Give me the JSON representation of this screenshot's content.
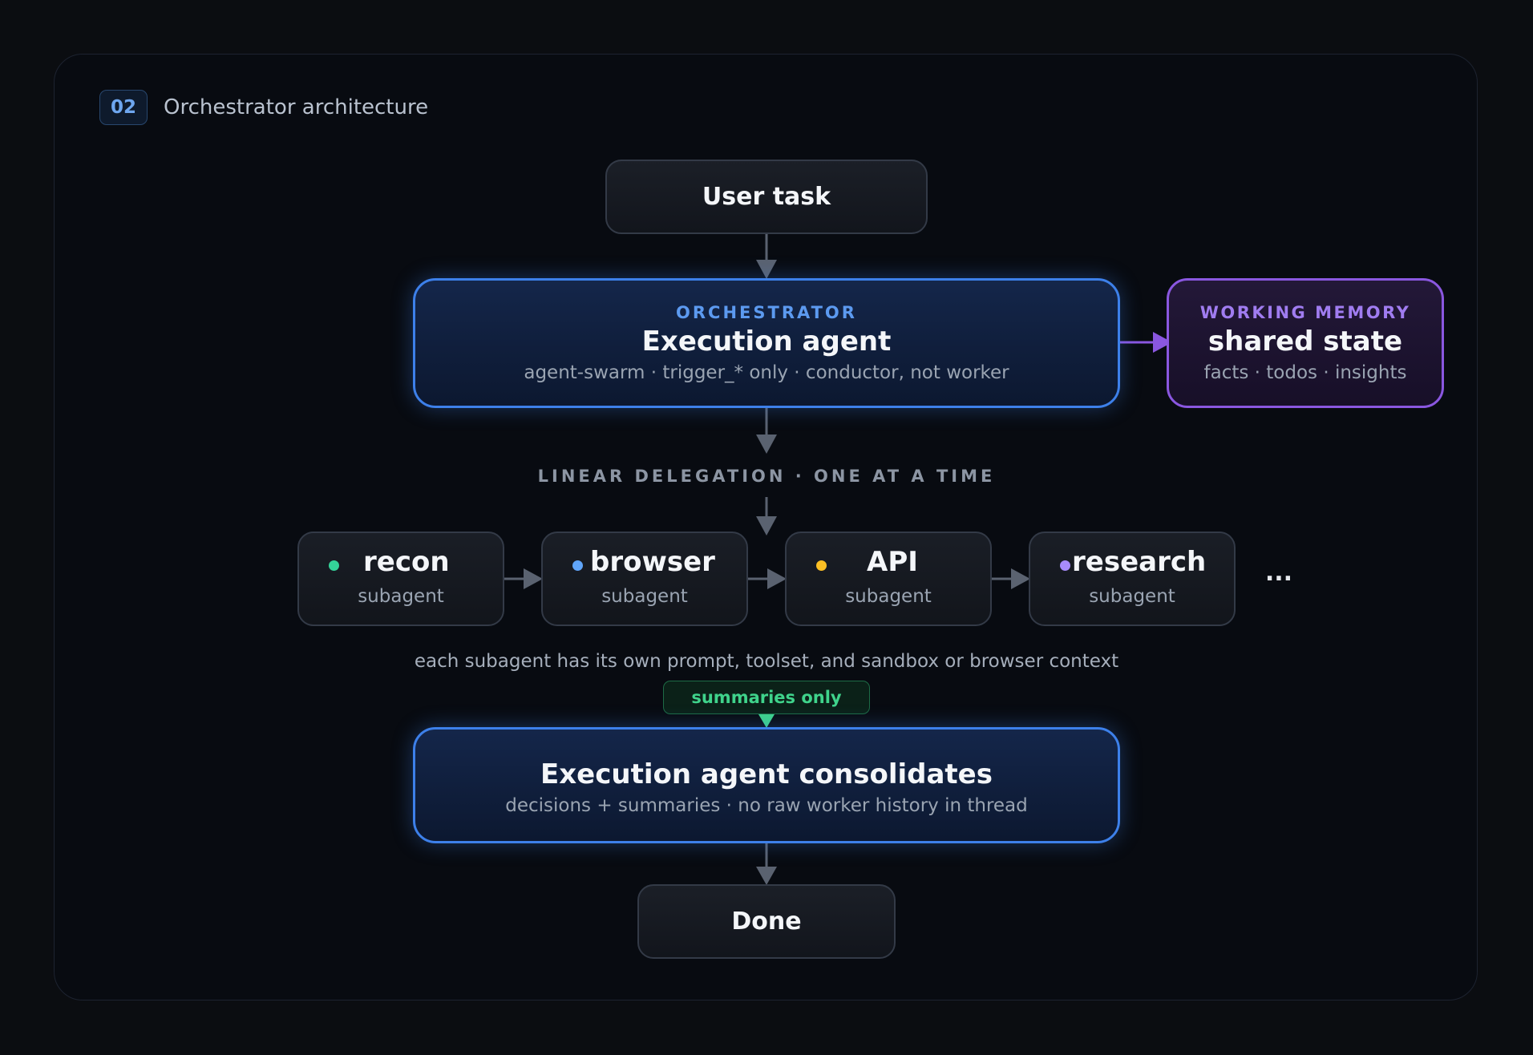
{
  "section": {
    "number": "02",
    "title": "Orchestrator architecture"
  },
  "nodes": {
    "user_task": "User task",
    "orchestrator": {
      "kicker": "ORCHESTRATOR",
      "title": "Execution agent",
      "subtitle": "agent-swarm · trigger_* only · conductor, not worker"
    },
    "memory": {
      "kicker": "WORKING MEMORY",
      "title": "shared state",
      "subtitle": "facts · todos · insights"
    },
    "delegation_label": "LINEAR DELEGATION · ONE AT A TIME",
    "subagents": [
      {
        "name": "recon",
        "kind": "subagent",
        "dot_color": "#34d399"
      },
      {
        "name": "browser",
        "kind": "subagent",
        "dot_color": "#60a5fa"
      },
      {
        "name": "API",
        "kind": "subagent",
        "dot_color": "#fbbf24"
      },
      {
        "name": "research",
        "kind": "subagent",
        "dot_color": "#a78bfa"
      }
    ],
    "more": "...",
    "subagent_note": "each subagent has its own prompt, toolset, and sandbox or browser context",
    "summaries_pill": "summaries only",
    "consolidate": {
      "title": "Execution agent consolidates",
      "subtitle": "decisions + summaries · no raw worker history in thread"
    },
    "done": "Done"
  },
  "colors": {
    "accent_blue": "#3d80ea",
    "accent_purple": "#8a57e0",
    "accent_green": "#3fd38b",
    "arrow_gray": "#5a6270"
  }
}
